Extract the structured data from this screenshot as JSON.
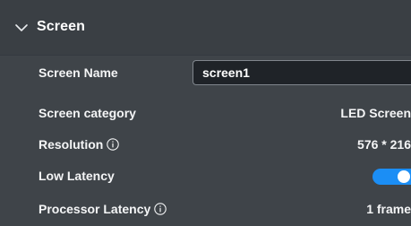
{
  "section": {
    "title": "Screen",
    "expanded": true,
    "chevron_icon": "chevron-down-icon"
  },
  "rows": {
    "screen_name": {
      "label": "Screen Name",
      "value": "screen1"
    },
    "screen_category": {
      "label": "Screen category",
      "value": "LED Screen"
    },
    "resolution": {
      "label": "Resolution",
      "info_icon": "info-circle-icon",
      "value": "576 * 216"
    },
    "low_latency": {
      "label": "Low Latency",
      "enabled": true
    },
    "processor_latency": {
      "label": "Processor Latency",
      "info_icon": "info-circle-icon",
      "value": "1 frame"
    }
  },
  "colors": {
    "panel_background": "#3f4449",
    "header_background": "#3a3f44",
    "input_background": "#1f2328",
    "toggle_on": "#1b8ef5",
    "text": "#f4f5f6"
  }
}
